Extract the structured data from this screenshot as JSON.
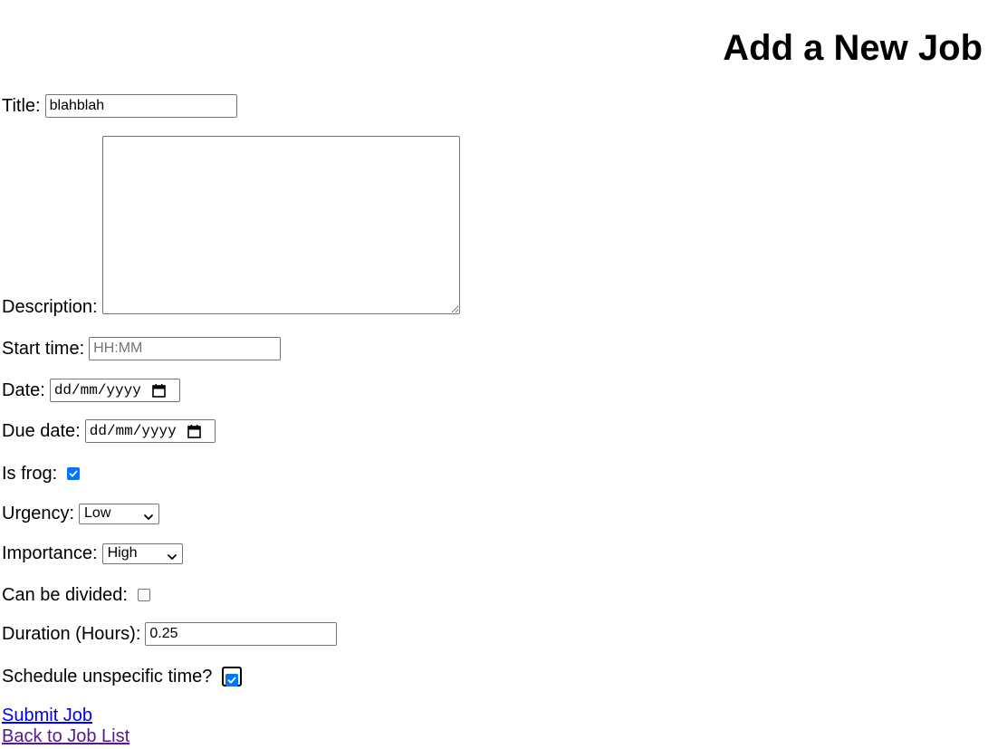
{
  "page": {
    "title": "Add a New Job"
  },
  "form": {
    "title": {
      "label": "Title:",
      "value": "blahblah"
    },
    "description": {
      "label": "Description:",
      "value": ""
    },
    "start_time": {
      "label": "Start time:",
      "placeholder": "HH:MM",
      "value": ""
    },
    "date": {
      "label": "Date:",
      "placeholder": "dd/mm/yyyy"
    },
    "due_date": {
      "label": "Due date:",
      "placeholder": "dd/mm/yyyy"
    },
    "is_frog": {
      "label": "Is frog:",
      "checked": true
    },
    "urgency": {
      "label": "Urgency:",
      "selected": "Low"
    },
    "importance": {
      "label": "Importance:",
      "selected": "High"
    },
    "can_be_divided": {
      "label": "Can be divided:",
      "checked": false
    },
    "duration": {
      "label": "Duration (Hours):",
      "value": "0.25"
    },
    "schedule_unspecific": {
      "label": "Schedule unspecific time?",
      "checked": true
    }
  },
  "links": {
    "submit": "Submit Job",
    "back": "Back to Job List"
  },
  "colors": {
    "checkbox_checked": "#0075ff",
    "link_unvisited": "#0000ee",
    "link_visited": "#551a8b"
  },
  "icons": {
    "calendar": "calendar-icon",
    "dropdown": "chevron-down-icon",
    "check": "checkmark-icon"
  }
}
